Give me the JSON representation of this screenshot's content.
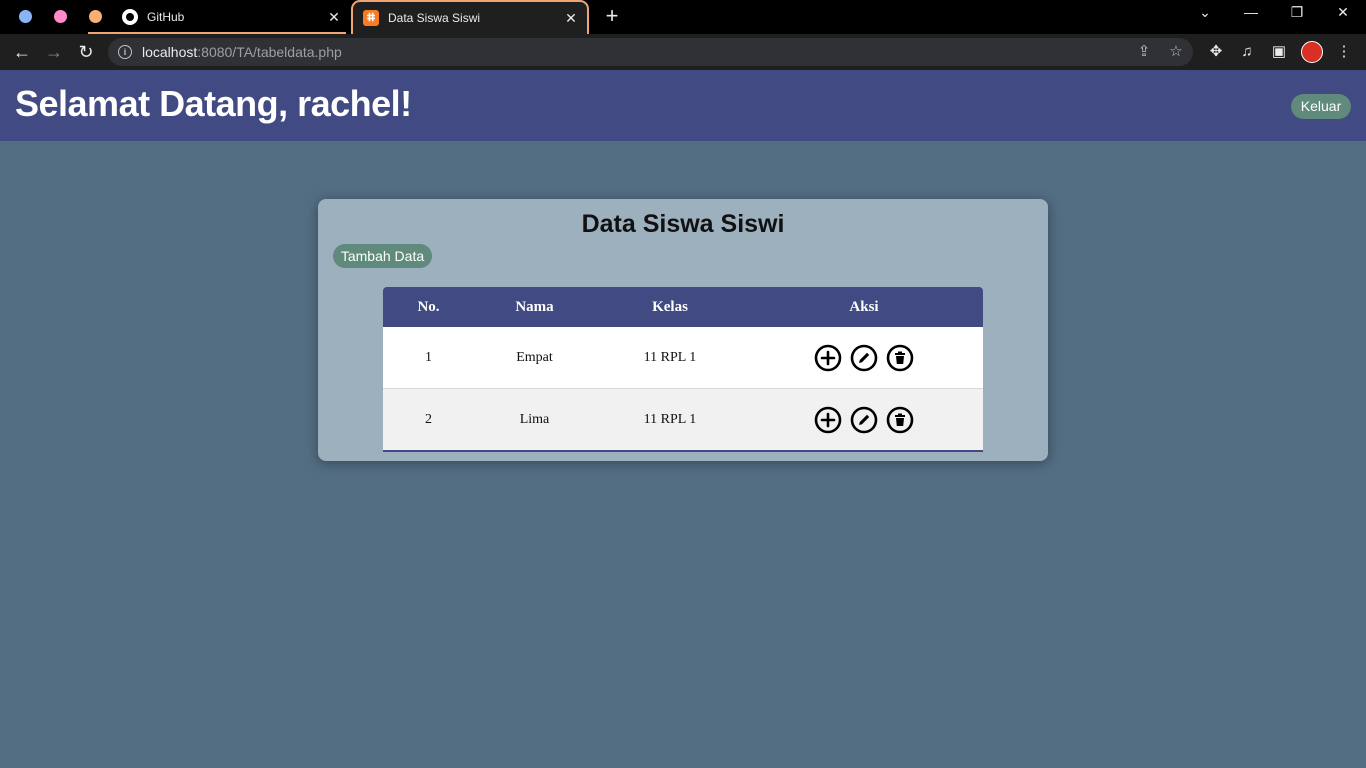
{
  "browser": {
    "tab_groups": [
      {
        "color": "#8ab4f8"
      },
      {
        "color": "#ff8bcb"
      },
      {
        "color": "#fcad70"
      }
    ],
    "tabs": [
      {
        "title": "GitHub",
        "icon": "github-icon",
        "active": false
      },
      {
        "title": "Data Siswa Siswi",
        "icon": "xampp-icon",
        "active": true
      }
    ],
    "url_host": "localhost",
    "url_rest": ":8080/TA/tabeldata.php"
  },
  "header": {
    "welcome": "Selamat Datang, rachel!",
    "logout_label": "Keluar"
  },
  "card": {
    "title": "Data Siswa Siswi",
    "add_label": "Tambah Data"
  },
  "table": {
    "columns": [
      "No.",
      "Nama",
      "Kelas",
      "Aksi"
    ],
    "rows": [
      {
        "no": "1",
        "nama": "Empat",
        "kelas": "11 RPL 1",
        "actions": [
          "plus-circle-icon",
          "edit-icon",
          "delete-icon"
        ]
      },
      {
        "no": "2",
        "nama": "Lima",
        "kelas": "11 RPL 1",
        "actions": [
          "plus-circle-icon",
          "edit-icon",
          "delete-icon"
        ]
      }
    ]
  },
  "colors": {
    "page_bg": "#536d83",
    "header_bg": "#414a82",
    "card_bg": "#9db0be",
    "button_bg": "#5f8a7c",
    "tab_accent": "#f0a576"
  }
}
